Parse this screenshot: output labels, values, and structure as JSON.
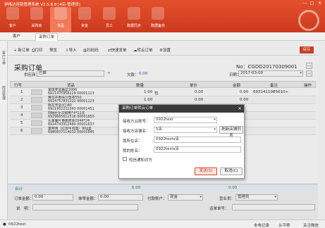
{
  "app": {
    "title": "伊格达连锁管理系统 V2.5.8.8 [4店-管理员]",
    "win_min": "—",
    "win_max": "□",
    "win_close": "✕"
  },
  "nav": [
    {
      "label": "客户"
    },
    {
      "label": "采购商"
    },
    {
      "label": "货品"
    },
    {
      "label": "资金"
    },
    {
      "label": "员工"
    },
    {
      "label": "数据同步"
    },
    {
      "label": "数据备份"
    }
  ],
  "tabs": [
    {
      "label": "客户"
    },
    {
      "label": "采购订单"
    }
  ],
  "left_vtabs": [
    "客户订单",
    "库存管理"
  ],
  "toolbar": {
    "new": "新订单",
    "print": "打印",
    "preview": "预览",
    "import": "导入",
    "barcode": "扫码码",
    "quick_send": "快速发单",
    "transfer": "转云订单",
    "settings": "设置",
    "save": "保存"
  },
  "order": {
    "title": "采购订单",
    "no_label": "No：",
    "no_value": "CGDD20170309001",
    "supplier_label": "供应商：",
    "supplier_value": "巴邮",
    "count_label": "欠款：",
    "count_value": "0.00",
    "date_label": "日期：",
    "date_value": "2017-03-09"
  },
  "grid": {
    "headers": [
      "行号",
      "货品",
      "数量",
      "单价",
      "金额",
      "备注",
      "操作"
    ],
    "rows": [
      {
        "no": "1",
        "name1": "美琪芙蓝雅蓝2006",
        "name2": "6921475958229 00001113",
        "qty": "1.00",
        "unit": "包",
        "price": "0.00",
        "price2": "0.00",
        "amount": "0.00",
        "remark": "6931411985610+"
      },
      {
        "no": "2",
        "name1": "黄花开香味沙塑茶550",
        "name2": "6924757831222 00001123",
        "qty": "1.00",
        "unit": "",
        "price": "0.00",
        "price2": "0.00",
        "amount": "0.00",
        "remark": ""
      },
      {
        "no": "3",
        "name1": "晓花芳蓝(红)80",
        "name2": "6921952222363 00001451",
        "qty": "",
        "unit": "",
        "price": "",
        "price2": "",
        "amount": "",
        "remark": ""
      },
      {
        "no": "4",
        "name1": "阿帕杜尔次鲸鸭*4*12双",
        "name2": "6929665612316 00001650",
        "qty": "",
        "unit": "",
        "price": "",
        "price2": "",
        "amount": "",
        "remark": ""
      },
      {
        "no": "5",
        "name1": "乐事薯片香脆原味1044*24",
        "name2": "6924743912469 00001637",
        "qty": "",
        "unit": "",
        "price": "",
        "price2": "",
        "amount": "",
        "remark": ""
      },
      {
        "no": "6",
        "name1": "康师傅（红烧牛肉面）90g盒",
        "name2": "6980837114032 00001845",
        "qty": "",
        "unit": "",
        "price": "",
        "price2": "",
        "amount": "",
        "remark": ""
      }
    ]
  },
  "summary": {
    "label": "合计",
    "qty_total": "6.00",
    "amount_total": "0.00"
  },
  "bottom": {
    "fee_label": "订单金额：",
    "fee_value": "0.00",
    "discount_label": "抹零金额：",
    "discount_value": "0.00",
    "paid_label": "付款账户：",
    "paid_value": "现金",
    "salesman_label": "营业员：",
    "salesman_value": "管理员",
    "note_label": "说　明：",
    "contact_label": "运单单号："
  },
  "status": {
    "user": "0922test",
    "sync": "未电记录",
    "exit": "从平移",
    "focus": "关注微信"
  },
  "dialog": {
    "title": "采购订单转云订单",
    "field1_label": "接收方云账号：",
    "field1_value": "0922test",
    "field2_label": "接收方店铺名：",
    "field2_value": "5店",
    "refresh": "刷新店铺列表",
    "field3_label": "我所在店：",
    "field3_value": "0922tests店",
    "field4_label": "我的姓名：",
    "field4_value": "0922tests店",
    "checkbox": "短信通知对方",
    "ok": "发送(S)",
    "cancel": "取消(C)"
  }
}
